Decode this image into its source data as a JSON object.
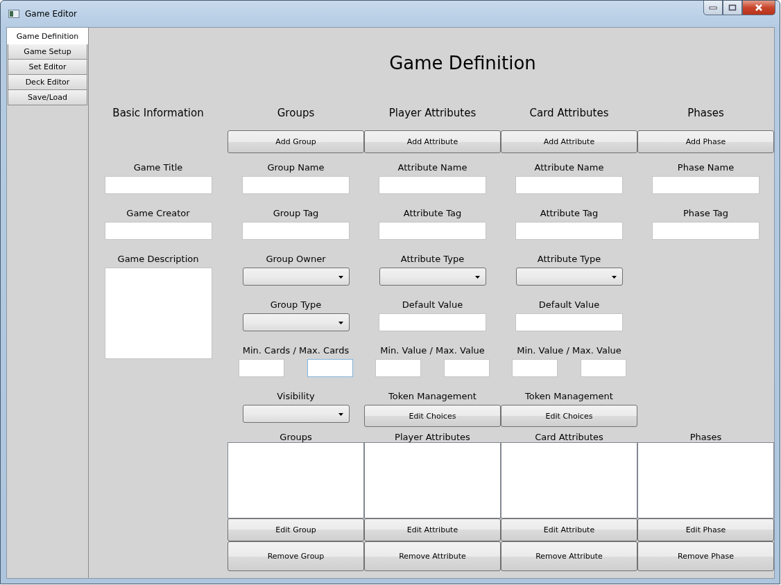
{
  "window": {
    "title": "Game Editor"
  },
  "tabs": [
    {
      "label": "Game Definition",
      "selected": true
    },
    {
      "label": "Game Setup",
      "selected": false
    },
    {
      "label": "Set Editor",
      "selected": false
    },
    {
      "label": "Deck Editor",
      "selected": false
    },
    {
      "label": "Save/Load",
      "selected": false
    }
  ],
  "page_title": "Game Definition",
  "basic": {
    "heading": "Basic Information",
    "fields": [
      {
        "kind": "text",
        "label": "Game Title"
      },
      {
        "kind": "text",
        "label": "Game Creator"
      },
      {
        "kind": "textarea",
        "label": "Game Description"
      }
    ]
  },
  "columns": [
    {
      "heading": "Groups",
      "add_button": "Add Group",
      "fields": [
        {
          "kind": "text",
          "label": "Group Name"
        },
        {
          "kind": "text",
          "label": "Group Tag"
        },
        {
          "kind": "dropdown",
          "label": "Group Owner"
        },
        {
          "kind": "dropdown",
          "label": "Group Type"
        },
        {
          "kind": "range",
          "label": "Min. Cards / Max. Cards",
          "max_focused": true
        },
        {
          "kind": "dropdown",
          "label": "Visibility"
        }
      ],
      "list_label": "Groups",
      "edit_button": "Edit Group",
      "remove_button": "Remove Group"
    },
    {
      "heading": "Player Attributes",
      "add_button": "Add Attribute",
      "fields": [
        {
          "kind": "text",
          "label": "Attribute Name"
        },
        {
          "kind": "text",
          "label": "Attribute Tag"
        },
        {
          "kind": "dropdown",
          "label": "Attribute Type"
        },
        {
          "kind": "text",
          "label": "Default Value"
        },
        {
          "kind": "range",
          "label": "Min. Value / Max. Value",
          "max_focused": false
        },
        {
          "kind": "button",
          "label": "Token Management",
          "button": "Edit Choices"
        }
      ],
      "list_label": "Player Attributes",
      "edit_button": "Edit Attribute",
      "remove_button": "Remove Attribute"
    },
    {
      "heading": "Card Attributes",
      "add_button": "Add Attribute",
      "fields": [
        {
          "kind": "text",
          "label": "Attribute Name"
        },
        {
          "kind": "text",
          "label": "Attribute Tag"
        },
        {
          "kind": "dropdown",
          "label": "Attribute Type"
        },
        {
          "kind": "text",
          "label": "Default Value"
        },
        {
          "kind": "range",
          "label": "Min. Value / Max. Value",
          "max_focused": false
        },
        {
          "kind": "button",
          "label": "Token Management",
          "button": "Edit Choices"
        }
      ],
      "list_label": "Card Attributes",
      "edit_button": "Edit Attribute",
      "remove_button": "Remove Attribute"
    },
    {
      "heading": "Phases",
      "add_button": "Add Phase",
      "fields": [
        {
          "kind": "text",
          "label": "Phase Name"
        },
        {
          "kind": "text",
          "label": "Phase Tag"
        }
      ],
      "list_label": "Phases",
      "edit_button": "Edit Phase",
      "remove_button": "Remove Phase"
    }
  ]
}
